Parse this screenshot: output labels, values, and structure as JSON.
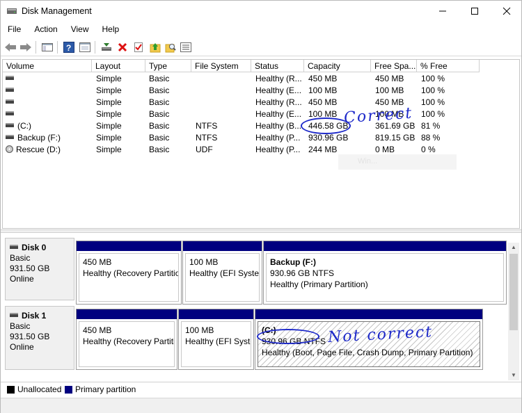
{
  "window": {
    "title": "Disk Management"
  },
  "menu": [
    "File",
    "Action",
    "View",
    "Help"
  ],
  "toolbar": [
    "back-arrow",
    "forward-arrow",
    "console-tree",
    "help",
    "properties",
    "connect-disk",
    "delete",
    "check",
    "up-folder",
    "search",
    "list-view"
  ],
  "volumes": {
    "columns": [
      "Volume",
      "Layout",
      "Type",
      "File System",
      "Status",
      "Capacity",
      "Free Spa...",
      "% Free"
    ],
    "rows": [
      {
        "icon": "drive",
        "volume": "",
        "layout": "Simple",
        "type": "Basic",
        "fs": "",
        "status": "Healthy (R...",
        "capacity": "450 MB",
        "free": "450 MB",
        "pct": "100 %"
      },
      {
        "icon": "drive",
        "volume": "",
        "layout": "Simple",
        "type": "Basic",
        "fs": "",
        "status": "Healthy (E...",
        "capacity": "100 MB",
        "free": "100 MB",
        "pct": "100 %"
      },
      {
        "icon": "drive",
        "volume": "",
        "layout": "Simple",
        "type": "Basic",
        "fs": "",
        "status": "Healthy (R...",
        "capacity": "450 MB",
        "free": "450 MB",
        "pct": "100 %"
      },
      {
        "icon": "drive",
        "volume": "",
        "layout": "Simple",
        "type": "Basic",
        "fs": "",
        "status": "Healthy (E...",
        "capacity": "100 MB",
        "free": "100 MB",
        "pct": "100 %"
      },
      {
        "icon": "drive",
        "volume": "(C:)",
        "layout": "Simple",
        "type": "Basic",
        "fs": "NTFS",
        "status": "Healthy (B...",
        "capacity": "446.58 GB",
        "free": "361.69 GB",
        "pct": "81 %"
      },
      {
        "icon": "drive",
        "volume": "Backup (F:)",
        "layout": "Simple",
        "type": "Basic",
        "fs": "NTFS",
        "status": "Healthy (P...",
        "capacity": "930.96 GB",
        "free": "819.15 GB",
        "pct": "88 %"
      },
      {
        "icon": "cd",
        "volume": "Rescue (D:)",
        "layout": "Simple",
        "type": "Basic",
        "fs": "UDF",
        "status": "Healthy (P...",
        "capacity": "244 MB",
        "free": "0 MB",
        "pct": "0 %"
      }
    ]
  },
  "watermark": "Win...",
  "disks": [
    {
      "name": "Disk 0",
      "type": "Basic",
      "size": "931.50 GB",
      "state": "Online",
      "partitions": [
        {
          "title": "",
          "line1": "450 MB",
          "line2": "Healthy (Recovery Partition)"
        },
        {
          "title": "",
          "line1": "100 MB",
          "line2": "Healthy (EFI System Partition)"
        },
        {
          "title": "Backup  (F:)",
          "line1": "930.96 GB NTFS",
          "line2": "Healthy (Primary Partition)"
        }
      ]
    },
    {
      "name": "Disk 1",
      "type": "Basic",
      "size": "931.50 GB",
      "state": "Online",
      "partitions": [
        {
          "title": "",
          "line1": "450 MB",
          "line2": "Healthy (Recovery Partition)"
        },
        {
          "title": "",
          "line1": "100 MB",
          "line2": "Healthy (EFI System Partition)"
        },
        {
          "title": "(C:)",
          "line1": "930.96 GB NTFS",
          "line2": "Healthy (Boot, Page File, Crash Dump, Primary Partition)"
        }
      ]
    }
  ],
  "legend": [
    {
      "label": "Unallocated",
      "color": "#000000"
    },
    {
      "label": "Primary partition",
      "color": "#00007f"
    }
  ],
  "annotations": {
    "correct": "Correct",
    "not_correct": "Not correct"
  }
}
